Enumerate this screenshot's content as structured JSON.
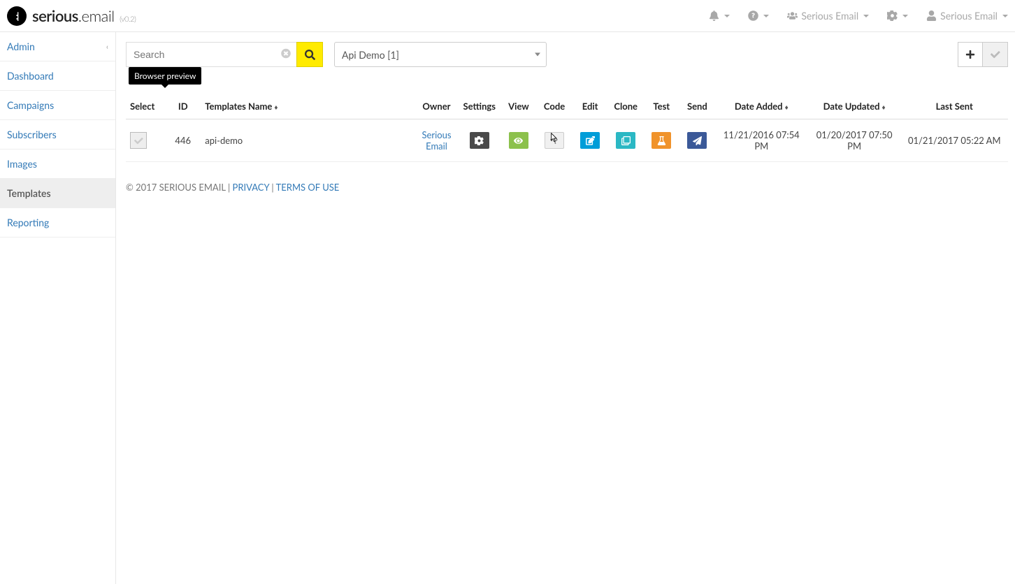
{
  "brand": {
    "prefix": "serious",
    "suffix": ".email",
    "version": "(v0.2)"
  },
  "topnav": {
    "team_label": "Serious Email",
    "user_label": "Serious Email"
  },
  "sidebar": {
    "items": [
      {
        "label": "Admin",
        "has_chevron": true,
        "active": false
      },
      {
        "label": "Dashboard",
        "active": false
      },
      {
        "label": "Campaigns",
        "active": false
      },
      {
        "label": "Subscribers",
        "active": false
      },
      {
        "label": "Images",
        "active": false
      },
      {
        "label": "Templates",
        "active": true
      },
      {
        "label": "Reporting",
        "active": false
      }
    ]
  },
  "toolbar": {
    "search_placeholder": "Search",
    "selected_campaign": "Api Demo [1]",
    "tooltip_code": "Browser preview"
  },
  "table": {
    "headers": {
      "select": "Select",
      "id": "ID",
      "name": "Templates Name",
      "owner": "Owner",
      "settings": "Settings",
      "view": "View",
      "code": "Code",
      "edit": "Edit",
      "clone": "Clone",
      "test": "Test",
      "send": "Send",
      "date_added": "Date Added",
      "date_updated": "Date Updated",
      "last_sent": "Last Sent"
    },
    "rows": [
      {
        "id": "446",
        "name": "api-demo",
        "owner": "Serious Email",
        "date_added": "11/21/2016 07:54 PM",
        "date_updated": "01/20/2017 07:50 PM",
        "last_sent": "01/21/2017 05:22 AM"
      }
    ]
  },
  "footer": {
    "copyright_prefix": "© 2017 SERIOUS EMAIL | ",
    "privacy": "PRIVACY",
    "sep": " | ",
    "terms": "TERMS OF USE"
  }
}
